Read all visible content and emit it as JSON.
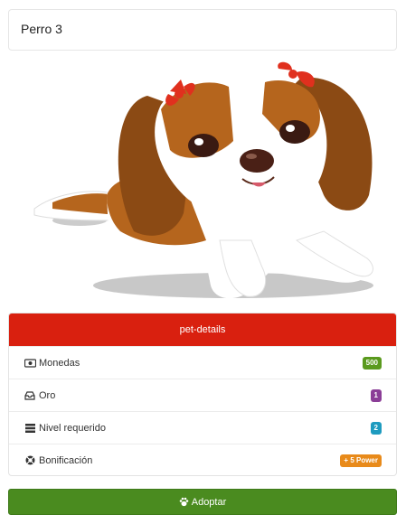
{
  "pet": {
    "name": "Perro 3",
    "image_icon": "dog-illustration"
  },
  "details": {
    "header": "pet-details",
    "rows": [
      {
        "icon": "money-icon",
        "label": "Monedas",
        "value": "500",
        "color": "#5a9a1e"
      },
      {
        "icon": "inbox-icon",
        "label": "Oro",
        "value": "1",
        "color": "#8b3d97"
      },
      {
        "icon": "server-icon",
        "label": "Nivel requerido",
        "value": "2",
        "color": "#1e9bbf"
      },
      {
        "icon": "lifebuoy-icon",
        "label": "Bonificación",
        "value": "+ 5 Power",
        "color": "#e88a1a"
      }
    ]
  },
  "actions": {
    "adopt_label": "Adoptar",
    "adopt_icon": "paw-icon"
  },
  "colors": {
    "header_red": "#d9200f",
    "adopt_green": "#4a8b1f"
  }
}
